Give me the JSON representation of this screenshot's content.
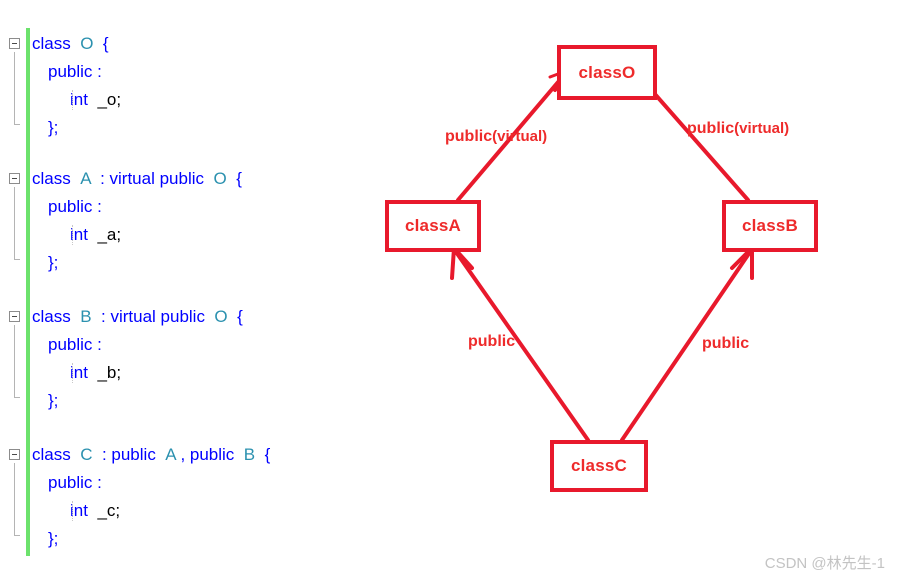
{
  "editor": {
    "change_indicator_color": "#6ce26c",
    "keyword_color": "#0000ff",
    "type_color": "#2b91af",
    "plain_color": "#000000",
    "blocks": [
      {
        "name": "class-o",
        "lines": [
          {
            "kw1": "class",
            "type1": "O",
            "tail": "{"
          },
          {
            "text": "public :"
          },
          {
            "kw": "int",
            "ident": "_o;"
          },
          {
            "text": "};"
          }
        ]
      },
      {
        "name": "class-a",
        "lines": [
          {
            "kw1": "class",
            "type1": "A",
            "mid": ": virtual public",
            "type2": "O",
            "tail": "{"
          },
          {
            "text": "public :"
          },
          {
            "kw": "int",
            "ident": "_a;"
          },
          {
            "text": "};"
          }
        ]
      },
      {
        "name": "class-b",
        "lines": [
          {
            "kw1": "class",
            "type1": "B",
            "mid": ": virtual public",
            "type2": "O",
            "tail": "{"
          },
          {
            "text": "public :"
          },
          {
            "kw": "int",
            "ident": "_b;"
          },
          {
            "text": "};"
          }
        ]
      },
      {
        "name": "class-c",
        "lines": [
          {
            "kw1": "class",
            "type1": "C",
            "mid": ": public",
            "type2": "A",
            "mid2": ", public",
            "type3": "B",
            "tail": "{"
          },
          {
            "text": "public :"
          },
          {
            "kw": "int",
            "ident": "_c;"
          },
          {
            "text": "};"
          }
        ]
      }
    ]
  },
  "diagram": {
    "accent_color": "#e8192c",
    "text_color": "#ee2b2b",
    "nodes": [
      {
        "id": "classO",
        "label": "classO"
      },
      {
        "id": "classA",
        "label": "classA"
      },
      {
        "id": "classB",
        "label": "classB"
      },
      {
        "id": "classC",
        "label": "classC"
      }
    ],
    "edges": [
      {
        "from": "classA",
        "to": "classO",
        "label": "public",
        "suffix": "(virtual)"
      },
      {
        "from": "classB",
        "to": "classO",
        "label": "public",
        "suffix": "(virtual)"
      },
      {
        "from": "classC",
        "to": "classA",
        "label": "public",
        "suffix": ""
      },
      {
        "from": "classC",
        "to": "classB",
        "label": "public",
        "suffix": ""
      }
    ]
  },
  "watermark": {
    "text": "CSDN @林先生-1"
  }
}
